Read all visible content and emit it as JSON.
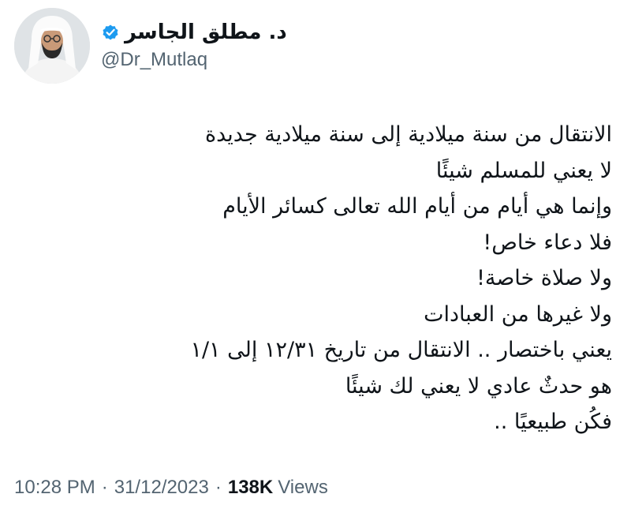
{
  "author": {
    "display_name": "د. مطلق الجاسر",
    "handle": "@Dr_Mutlaq",
    "verified": true,
    "verified_color": "#1d9bf0"
  },
  "tweet": {
    "lines": [
      "الانتقال من سنة ميلادية إلى سنة ميلادية جديدة",
      "لا يعني للمسلم شيئًا",
      "وإنما هي أيام من أيام الله تعالى كسائر الأيام",
      "فلا دعاء خاص!",
      "ولا صلاة خاصة!",
      "ولا غيرها من العبادات",
      "يعني باختصار .. الانتقال من تاريخ ١٢/٣١ إلى ١/١",
      "هو حدثٌ عادي لا يعني لك شيئًا",
      "فكُن طبيعيًا .."
    ]
  },
  "meta": {
    "time": "10:28 PM",
    "separator": "·",
    "date": "31/12/2023",
    "views_count": "138K",
    "views_label": "Views"
  },
  "colors": {
    "text": "#0f1419",
    "secondary": "#536471",
    "background": "#ffffff"
  }
}
